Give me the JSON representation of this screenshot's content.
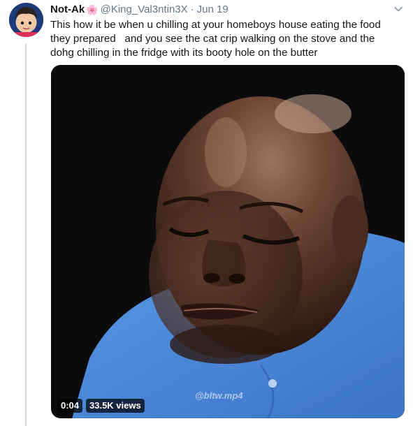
{
  "tweet": {
    "display_name": "Not-Ak",
    "name_emoji": "🌸",
    "handle": "@King_Val3ntin3X",
    "separator": "·",
    "date": "Jun 19",
    "text": "This how it be when u chilling at your homeboys house eating the food\nthey prepared   and you see the cat crip walking on the stove and the\ndohg chilling in the fridge with its booty hole on the butter"
  },
  "media": {
    "duration": "0:04",
    "views": "33.5K views",
    "watermark": "@bltw.mp4"
  },
  "icons": {
    "menu": "chevron-down-icon",
    "avatar": "avatar"
  },
  "colors": {
    "text": "#14171a",
    "muted": "#657786",
    "thread_line": "#cfd9de",
    "shirt": "#4f8fe0"
  }
}
